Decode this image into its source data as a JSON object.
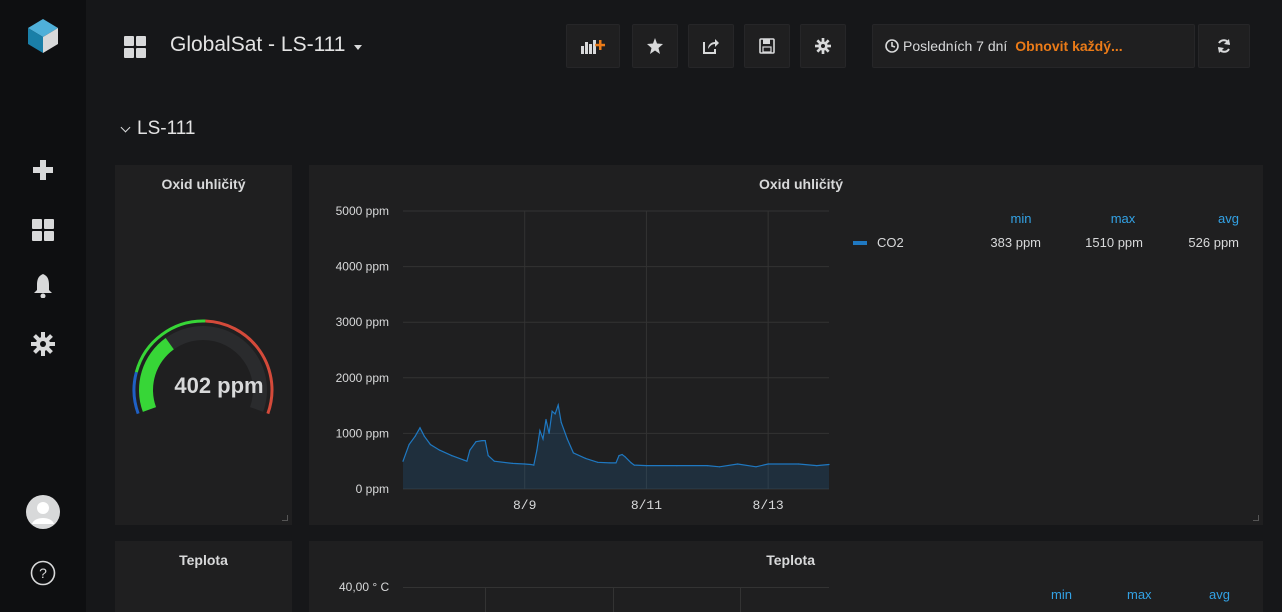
{
  "topbar": {
    "dashboard_title": "GlobalSat - LS-111",
    "time_range": "Posledních 7 dní",
    "refresh_label": "Obnovit každý..."
  },
  "row": {
    "title": "LS-111"
  },
  "gauge_panel": {
    "title": "Oxid uhličitý",
    "value": 402,
    "value_text": "402 ppm"
  },
  "graph_panel": {
    "title": "Oxid uhličitý",
    "legend": {
      "headers": [
        "min",
        "max",
        "avg"
      ],
      "series_name": "CO2",
      "min": "383 ppm",
      "max": "1510 ppm",
      "avg": "526 ppm"
    }
  },
  "temp_gauge_panel": {
    "title": "Teplota"
  },
  "temp_graph_panel": {
    "title": "Teplota",
    "y_tick_top": "40,00 ° C",
    "legend": {
      "headers": [
        "min",
        "max",
        "avg"
      ]
    }
  },
  "colors": {
    "accent_orange": "#eb7b18",
    "series_blue": "#1f78c1",
    "gauge_green": "#37d637",
    "gauge_red": "#d44a3a",
    "gauge_blue": "#1f60c4"
  },
  "chart_data": {
    "type": "area",
    "title": "Oxid uhličitý",
    "ylim": [
      0,
      5000
    ],
    "y_ticks": [
      "0 ppm",
      "1000 ppm",
      "2000 ppm",
      "3000 ppm",
      "4000 ppm",
      "5000 ppm"
    ],
    "x_ticks": [
      "8/9",
      "8/11",
      "8/13"
    ],
    "x_tick_days": [
      2,
      4,
      6
    ],
    "x_range_days": [
      0,
      7
    ],
    "series": [
      {
        "name": "CO2",
        "points": [
          [
            0.0,
            500
          ],
          [
            0.1,
            800
          ],
          [
            0.2,
            950
          ],
          [
            0.28,
            1100
          ],
          [
            0.35,
            950
          ],
          [
            0.45,
            800
          ],
          [
            0.6,
            700
          ],
          [
            0.8,
            600
          ],
          [
            1.0,
            520
          ],
          [
            1.05,
            500
          ],
          [
            1.1,
            700
          ],
          [
            1.2,
            850
          ],
          [
            1.3,
            870
          ],
          [
            1.35,
            870
          ],
          [
            1.4,
            600
          ],
          [
            1.5,
            500
          ],
          [
            1.8,
            460
          ],
          [
            2.0,
            450
          ],
          [
            2.1,
            440
          ],
          [
            2.15,
            430
          ],
          [
            2.2,
            700
          ],
          [
            2.25,
            1050
          ],
          [
            2.3,
            900
          ],
          [
            2.35,
            1250
          ],
          [
            2.4,
            1000
          ],
          [
            2.45,
            1400
          ],
          [
            2.5,
            1350
          ],
          [
            2.55,
            1510
          ],
          [
            2.6,
            1200
          ],
          [
            2.7,
            900
          ],
          [
            2.8,
            650
          ],
          [
            3.0,
            550
          ],
          [
            3.2,
            480
          ],
          [
            3.4,
            470
          ],
          [
            3.5,
            470
          ],
          [
            3.55,
            600
          ],
          [
            3.6,
            620
          ],
          [
            3.65,
            580
          ],
          [
            3.75,
            470
          ],
          [
            3.8,
            430
          ],
          [
            4.0,
            420
          ],
          [
            4.5,
            420
          ],
          [
            5.0,
            420
          ],
          [
            5.2,
            400
          ],
          [
            5.5,
            450
          ],
          [
            5.8,
            400
          ],
          [
            6.0,
            450
          ],
          [
            6.5,
            450
          ],
          [
            6.8,
            420
          ],
          [
            7.0,
            440
          ]
        ]
      }
    ]
  }
}
